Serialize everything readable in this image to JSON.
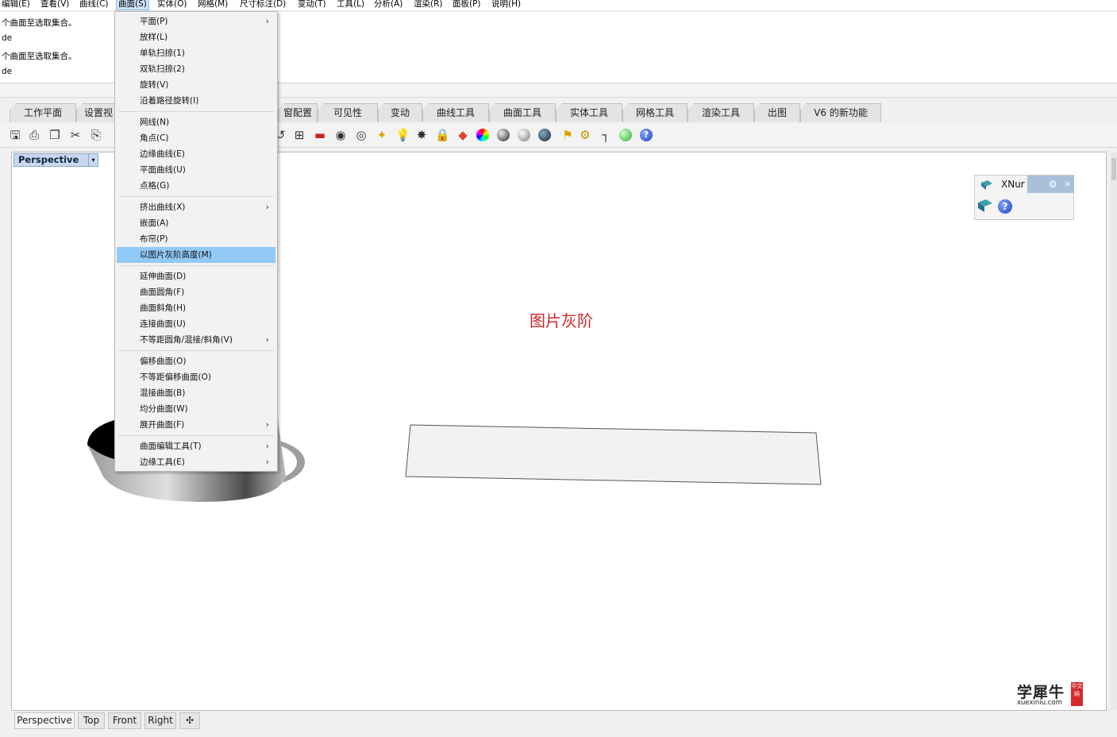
{
  "menubar": {
    "items": [
      "编辑(E)",
      "查看(V)",
      "曲线(C)",
      "曲面(S)",
      "实体(O)",
      "网格(M)",
      "尺寸标注(D)",
      "变动(T)",
      "工具(L)",
      "分析(A)",
      "渲染(R)",
      "面板(P)",
      "说明(H)"
    ],
    "active_item": "曲面(S)"
  },
  "command_history": {
    "lines": [
      "个曲面至选取集合。",
      "de",
      "个曲面至选取集合。",
      "de"
    ]
  },
  "toolbar_tabs": [
    "工作平面",
    "设置视",
    "窗配置",
    "可见性",
    "变动",
    "曲线工具",
    "曲面工具",
    "实体工具",
    "网格工具",
    "渲染工具",
    "出图",
    "V6 的新功能"
  ],
  "surface_menu": {
    "groups": [
      [
        {
          "label": "平面(P)",
          "submenu": true
        },
        {
          "label": "放样(L)",
          "submenu": false
        },
        {
          "label": "单轨扫掠(1)",
          "submenu": false
        },
        {
          "label": "双轨扫掠(2)",
          "submenu": false
        },
        {
          "label": "旋转(V)",
          "submenu": false
        },
        {
          "label": "沿着路径旋转(I)",
          "submenu": false
        }
      ],
      [
        {
          "label": "网线(N)",
          "submenu": false
        },
        {
          "label": "角点(C)",
          "submenu": false
        },
        {
          "label": "边缘曲线(E)",
          "submenu": false
        },
        {
          "label": "平面曲线(U)",
          "submenu": false
        },
        {
          "label": "点格(G)",
          "submenu": false
        }
      ],
      [
        {
          "label": "挤出曲线(X)",
          "submenu": true
        },
        {
          "label": "嵌面(A)",
          "submenu": false
        },
        {
          "label": "布帘(P)",
          "submenu": false
        },
        {
          "label": "以图片灰阶高度(M)",
          "submenu": false,
          "highlighted": true
        }
      ],
      [
        {
          "label": "延伸曲面(D)",
          "submenu": false
        },
        {
          "label": "曲面圆角(F)",
          "submenu": false
        },
        {
          "label": "曲面斜角(H)",
          "submenu": false
        },
        {
          "label": "连接曲面(U)",
          "submenu": false
        },
        {
          "label": "不等距圆角/混接/斜角(V)",
          "submenu": true
        }
      ],
      [
        {
          "label": "偏移曲面(O)",
          "submenu": false
        },
        {
          "label": "不等距偏移曲面(O)",
          "submenu": false
        },
        {
          "label": "混接曲面(B)",
          "submenu": false
        },
        {
          "label": "均分曲面(W)",
          "submenu": false
        },
        {
          "label": "展开曲面(F)",
          "submenu": true
        }
      ],
      [
        {
          "label": "曲面编辑工具(T)",
          "submenu": true
        },
        {
          "label": "边缘工具(E)",
          "submenu": true
        }
      ]
    ],
    "submenu_glyph": "›"
  },
  "viewport": {
    "title": "Perspective",
    "dropdown_glyph": "▾",
    "caption": "图片灰阶"
  },
  "xnurbs_panel": {
    "title": "XNur",
    "gear_glyph": "⚙",
    "close_glyph": "×",
    "help_glyph": "?"
  },
  "viewport_tabs": [
    "Perspective",
    "Top",
    "Front",
    "Right"
  ],
  "viewport_tab_add": "✣",
  "watermark": {
    "main": "学犀牛",
    "sub": "xuexiniu.com",
    "seal": "中文网"
  },
  "colors": {
    "menu_highlight": "#91c9f7",
    "viewport_label_bg": "#c8d8ee",
    "caption_red": "#d0282c"
  }
}
